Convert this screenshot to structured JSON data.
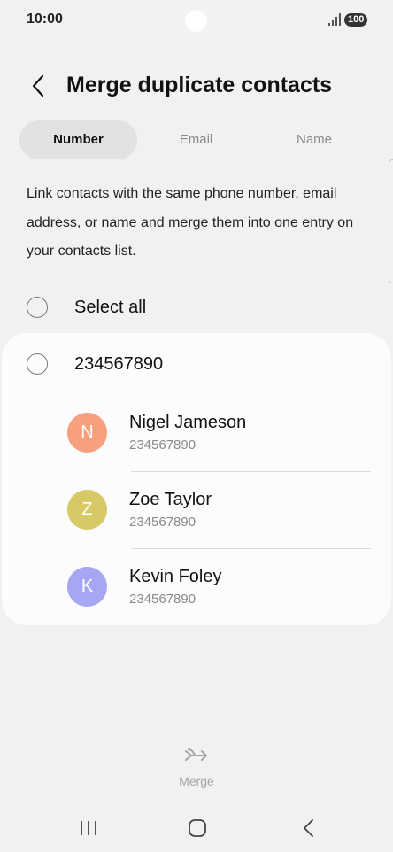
{
  "status_bar": {
    "time": "10:00",
    "battery": "100",
    "icons": [
      "signal-icon",
      "battery-icon"
    ]
  },
  "header": {
    "title": "Merge duplicate contacts",
    "back_icon": "chevron-left-icon"
  },
  "tabs": [
    {
      "label": "Number",
      "active": true
    },
    {
      "label": "Email",
      "active": false
    },
    {
      "label": "Name",
      "active": false
    }
  ],
  "description": "Link contacts with the same phone number, email address, or name and merge them into one entry on your contacts list.",
  "select_all": {
    "label": "Select all",
    "checked": false
  },
  "group": {
    "number": "234567890",
    "checked": false,
    "contacts": [
      {
        "name": "Nigel Jameson",
        "number": "234567890",
        "initial": "N",
        "avatar_color": "#f6a07e"
      },
      {
        "name": "Zoe Taylor",
        "number": "234567890",
        "initial": "Z",
        "avatar_color": "#d6c966"
      },
      {
        "name": "Kevin Foley",
        "number": "234567890",
        "initial": "K",
        "avatar_color": "#a6a7f3"
      }
    ]
  },
  "merge": {
    "label": "Merge",
    "icon": "merge-icon"
  },
  "nav_bar": {
    "icons": [
      "recents-icon",
      "home-icon",
      "back-icon"
    ]
  }
}
